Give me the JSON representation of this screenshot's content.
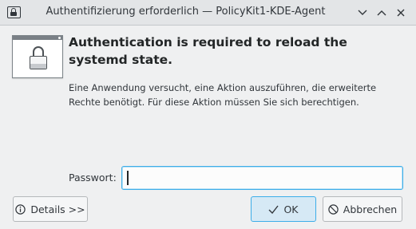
{
  "window": {
    "title": "Authentifizierung erforderlich — PolicyKit1-KDE-Agent"
  },
  "dialog": {
    "heading": "Authentication is required to reload the systemd state.",
    "description": "Eine Anwendung versucht, eine Aktion auszuführen, die erweiterte Rechte benötigt. Für diese Aktion müssen Sie sich berechtigen.",
    "password_label": "Passwort:",
    "password_value": ""
  },
  "buttons": {
    "details": "Details >>",
    "ok": "OK",
    "cancel": "Abbrechen"
  },
  "icons": {
    "app": "lock-icon",
    "dialog": "lock-window-icon",
    "details": "info-icon",
    "ok": "checkmark-icon",
    "cancel": "cancel-icon"
  },
  "colors": {
    "accent": "#3daee9",
    "background": "#eff0f1"
  }
}
